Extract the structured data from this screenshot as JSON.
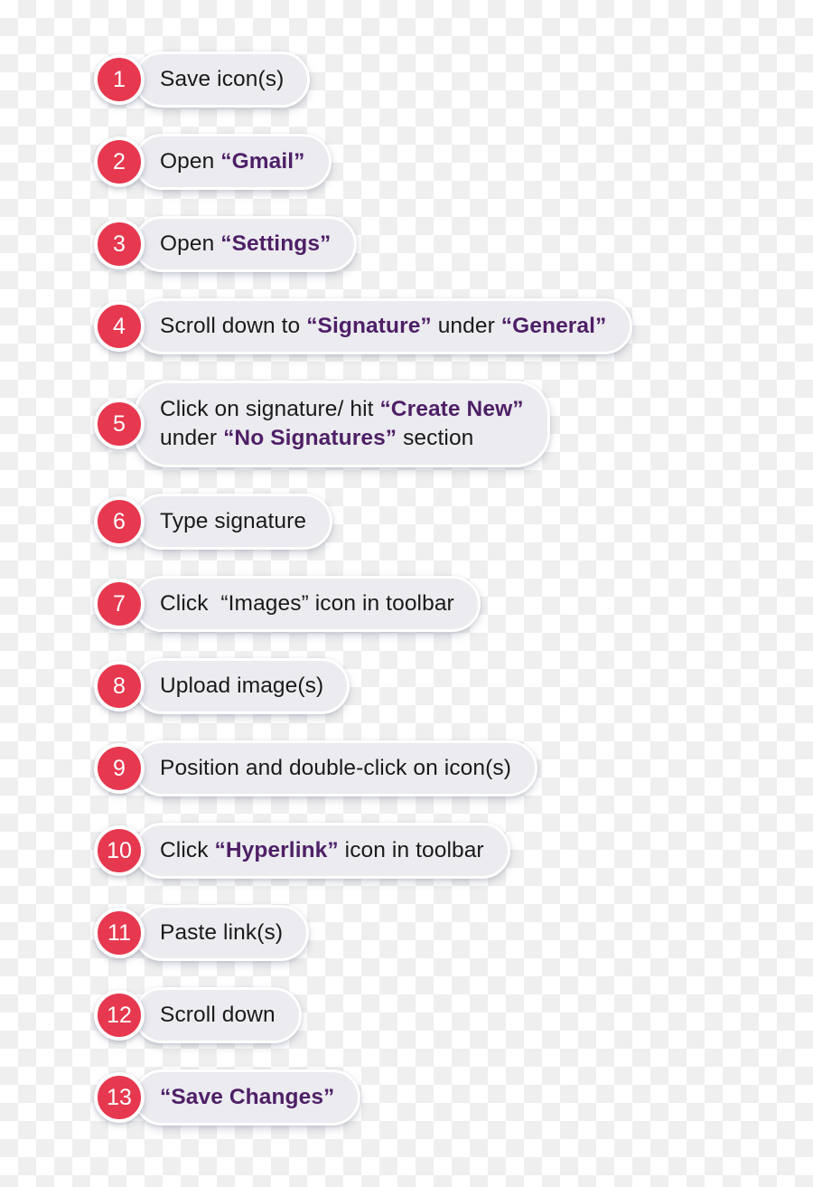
{
  "meta": {
    "kind": "numbered-step-list",
    "step_count": 13,
    "colors": {
      "badge_background": "#E6384F",
      "badge_text": "#FFFFFF",
      "badge_ring": "#FFFFFF",
      "pill_background": "#EBEBF0",
      "pill_ring": "#FFFFFF",
      "text_plain": "#1A1A1A",
      "text_emphasis": "#4E1F66",
      "checkerboard_light": "#FFFFFF",
      "checkerboard_dark": "#EFEFEF"
    }
  },
  "steps": [
    {
      "number": "1",
      "text": "Save icon(s)",
      "lines": [
        [
          {
            "t": "Save icon(s)",
            "em": false
          }
        ]
      ]
    },
    {
      "number": "2",
      "text": "Open “Gmail”",
      "lines": [
        [
          {
            "t": "Open ",
            "em": false
          },
          {
            "t": "“Gmail”",
            "em": true
          }
        ]
      ]
    },
    {
      "number": "3",
      "text": "Open “Settings”",
      "lines": [
        [
          {
            "t": "Open ",
            "em": false
          },
          {
            "t": "“Settings”",
            "em": true
          }
        ]
      ]
    },
    {
      "number": "4",
      "text": "Scroll down to “Signature” under “General”",
      "lines": [
        [
          {
            "t": "Scroll down to ",
            "em": false
          },
          {
            "t": "“Signature”",
            "em": true
          },
          {
            "t": " under ",
            "em": false
          },
          {
            "t": "“General”",
            "em": true
          }
        ]
      ]
    },
    {
      "number": "5",
      "text": "Click on signature/ hit “Create New” under “No Signatures” section",
      "lines": [
        [
          {
            "t": "Click on signature/ hit ",
            "em": false
          },
          {
            "t": "“Create New”",
            "em": true
          }
        ],
        [
          {
            "t": "under ",
            "em": false
          },
          {
            "t": "“No Signatures”",
            "em": true
          },
          {
            "t": " section",
            "em": false
          }
        ]
      ]
    },
    {
      "number": "6",
      "text": "Type signature",
      "lines": [
        [
          {
            "t": "Type signature",
            "em": false
          }
        ]
      ]
    },
    {
      "number": "7",
      "text": "Click  “Images” icon in toolbar",
      "lines": [
        [
          {
            "t": "Click  “Images” icon in toolbar",
            "em": false
          }
        ]
      ]
    },
    {
      "number": "8",
      "text": "Upload image(s)",
      "lines": [
        [
          {
            "t": "Upload image(s)",
            "em": false
          }
        ]
      ]
    },
    {
      "number": "9",
      "text": "Position and double-click on icon(s)",
      "lines": [
        [
          {
            "t": "Position and double-click on icon(s)",
            "em": false
          }
        ]
      ]
    },
    {
      "number": "10",
      "text": "Click “Hyperlink” icon in toolbar",
      "lines": [
        [
          {
            "t": "Click ",
            "em": false
          },
          {
            "t": "“Hyperlink”",
            "em": true
          },
          {
            "t": " icon in toolbar",
            "em": false
          }
        ]
      ]
    },
    {
      "number": "11",
      "text": "Paste link(s)",
      "lines": [
        [
          {
            "t": "Paste link(s)",
            "em": false
          }
        ]
      ]
    },
    {
      "number": "12",
      "text": "Scroll down",
      "lines": [
        [
          {
            "t": "Scroll down",
            "em": false
          }
        ]
      ]
    },
    {
      "number": "13",
      "text": "“Save Changes”",
      "lines": [
        [
          {
            "t": "“Save Changes”",
            "em": true
          }
        ]
      ]
    }
  ]
}
